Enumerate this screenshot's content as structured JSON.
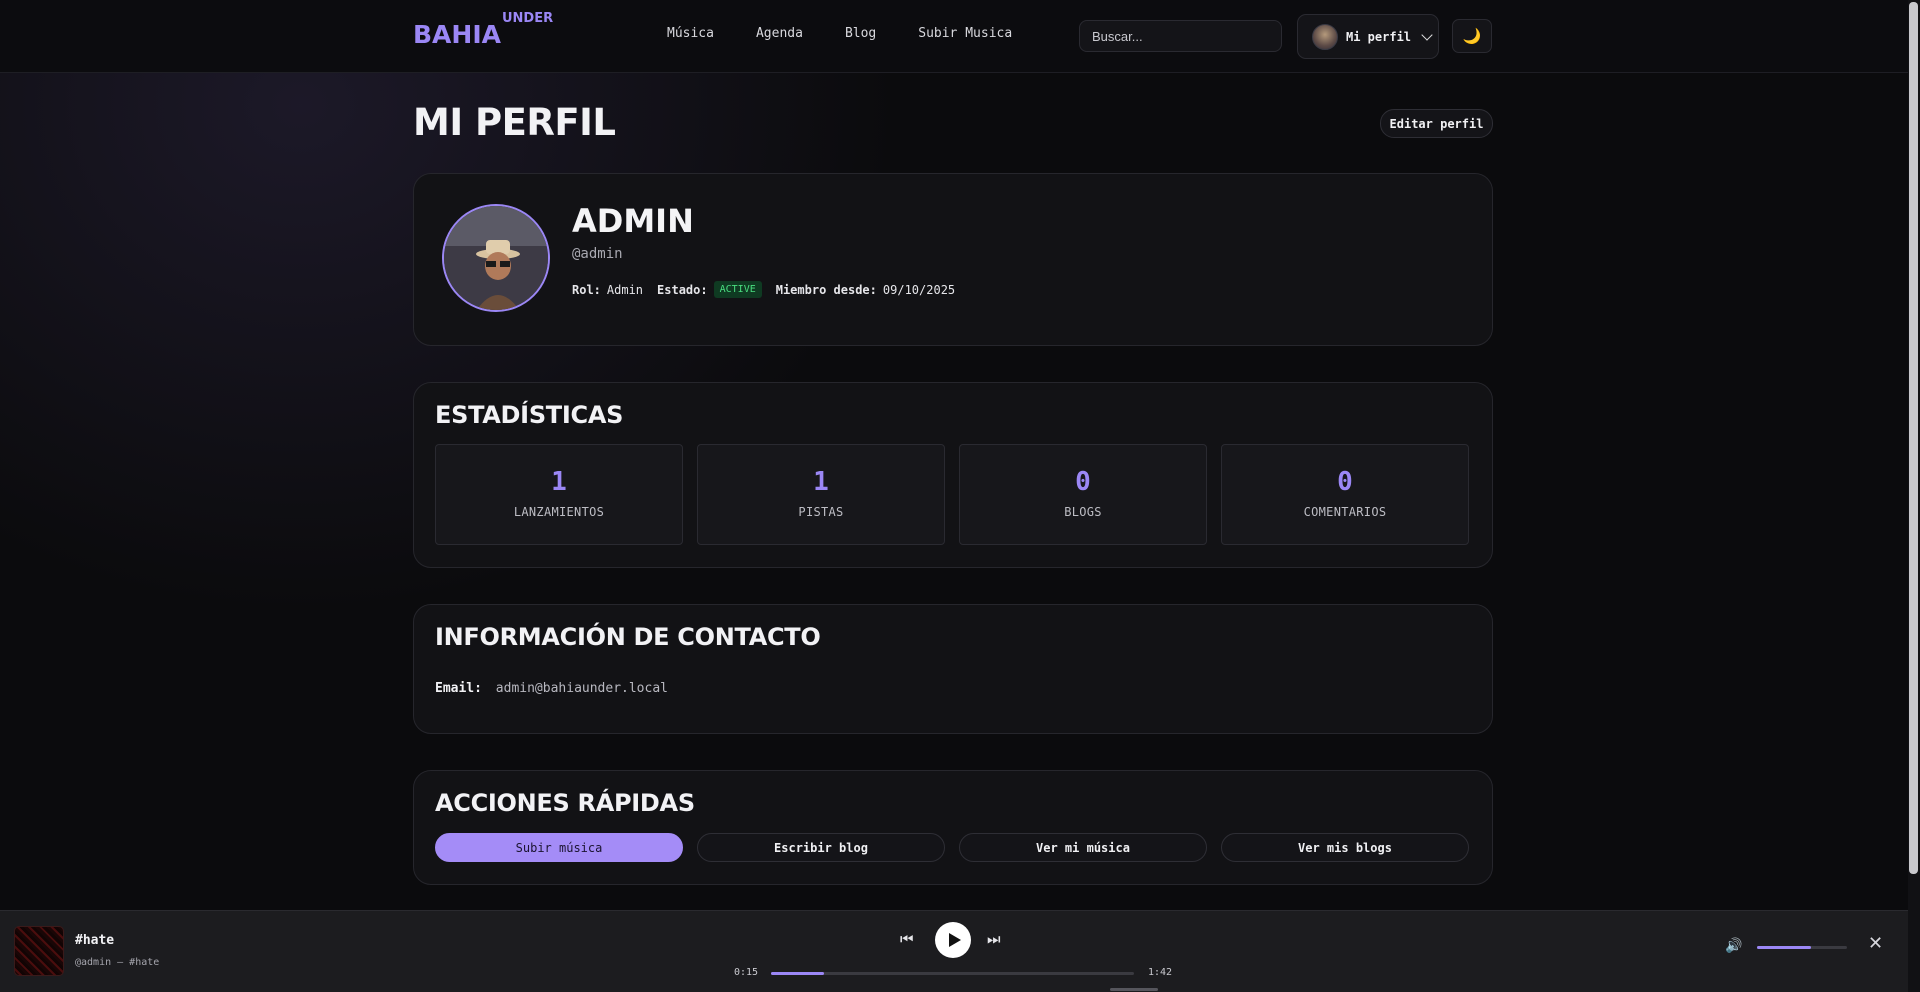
{
  "header": {
    "logo_main": "BAHIA",
    "logo_sup": "UNDER",
    "nav": [
      "Música",
      "Agenda",
      "Blog",
      "Subir Musica"
    ],
    "search_placeholder": "Buscar...",
    "profile_label": "Mi perfil",
    "theme_icon": "moon-icon"
  },
  "page": {
    "title": "MI PERFIL",
    "edit_label": "Editar perfil"
  },
  "profile": {
    "name": "ADMIN",
    "handle": "@admin",
    "role_label": "Rol:",
    "role": "Admin",
    "status_label": "Estado:",
    "status": "ACTIVE",
    "member_label": "Miembro desde:",
    "member_since": "09/10/2025",
    "status_color": "#4ade80"
  },
  "stats": {
    "title": "ESTADÍSTICAS",
    "items": [
      {
        "value": "1",
        "label": "LANZAMIENTOS"
      },
      {
        "value": "1",
        "label": "PISTAS"
      },
      {
        "value": "0",
        "label": "BLOGS"
      },
      {
        "value": "0",
        "label": "COMENTARIOS"
      }
    ]
  },
  "contact": {
    "title": "INFORMACIÓN DE CONTACTO",
    "email_label": "Email:",
    "email": "admin@bahiaunder.local"
  },
  "actions": {
    "title": "ACCIONES RÁPIDAS",
    "items": [
      "Subir música",
      "Escribir blog",
      "Ver mi música",
      "Ver mis blogs"
    ]
  },
  "player": {
    "track_title": "#hate",
    "track_sub": "@admin — #hate",
    "elapsed": "0:15",
    "duration": "1:42",
    "progress_fraction": 0.147,
    "volume_fraction": 0.6
  },
  "colors": {
    "accent": "#9b87f5",
    "background": "#0b0b0d",
    "card": "#121215"
  }
}
